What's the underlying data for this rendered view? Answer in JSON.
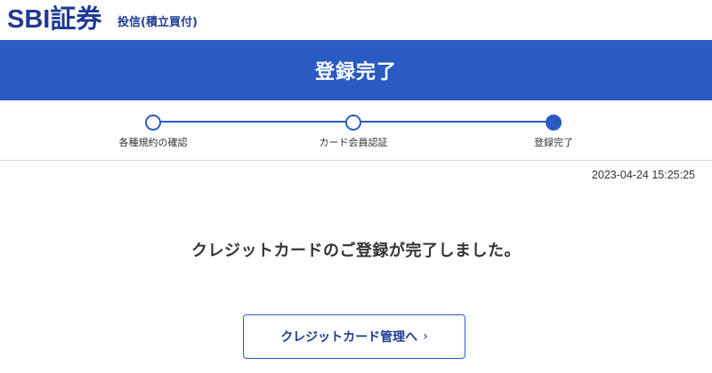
{
  "header": {
    "logo_text": "SBI証券",
    "service_name": "投信(積立買付)"
  },
  "title_band": {
    "title": "登録完了"
  },
  "stepper": {
    "steps": [
      {
        "label": "各種規約の確認",
        "state": "completed"
      },
      {
        "label": "カード会員認証",
        "state": "completed"
      },
      {
        "label": "登録完了",
        "state": "current"
      }
    ]
  },
  "timestamp": "2023-04-24 15:25:25",
  "message": "クレジットカードのご登録が完了しました。",
  "button": {
    "label": "クレジットカード管理へ",
    "chevron": "›"
  },
  "colors": {
    "brand": "#1f3a93",
    "accent": "#2a5bc4"
  }
}
